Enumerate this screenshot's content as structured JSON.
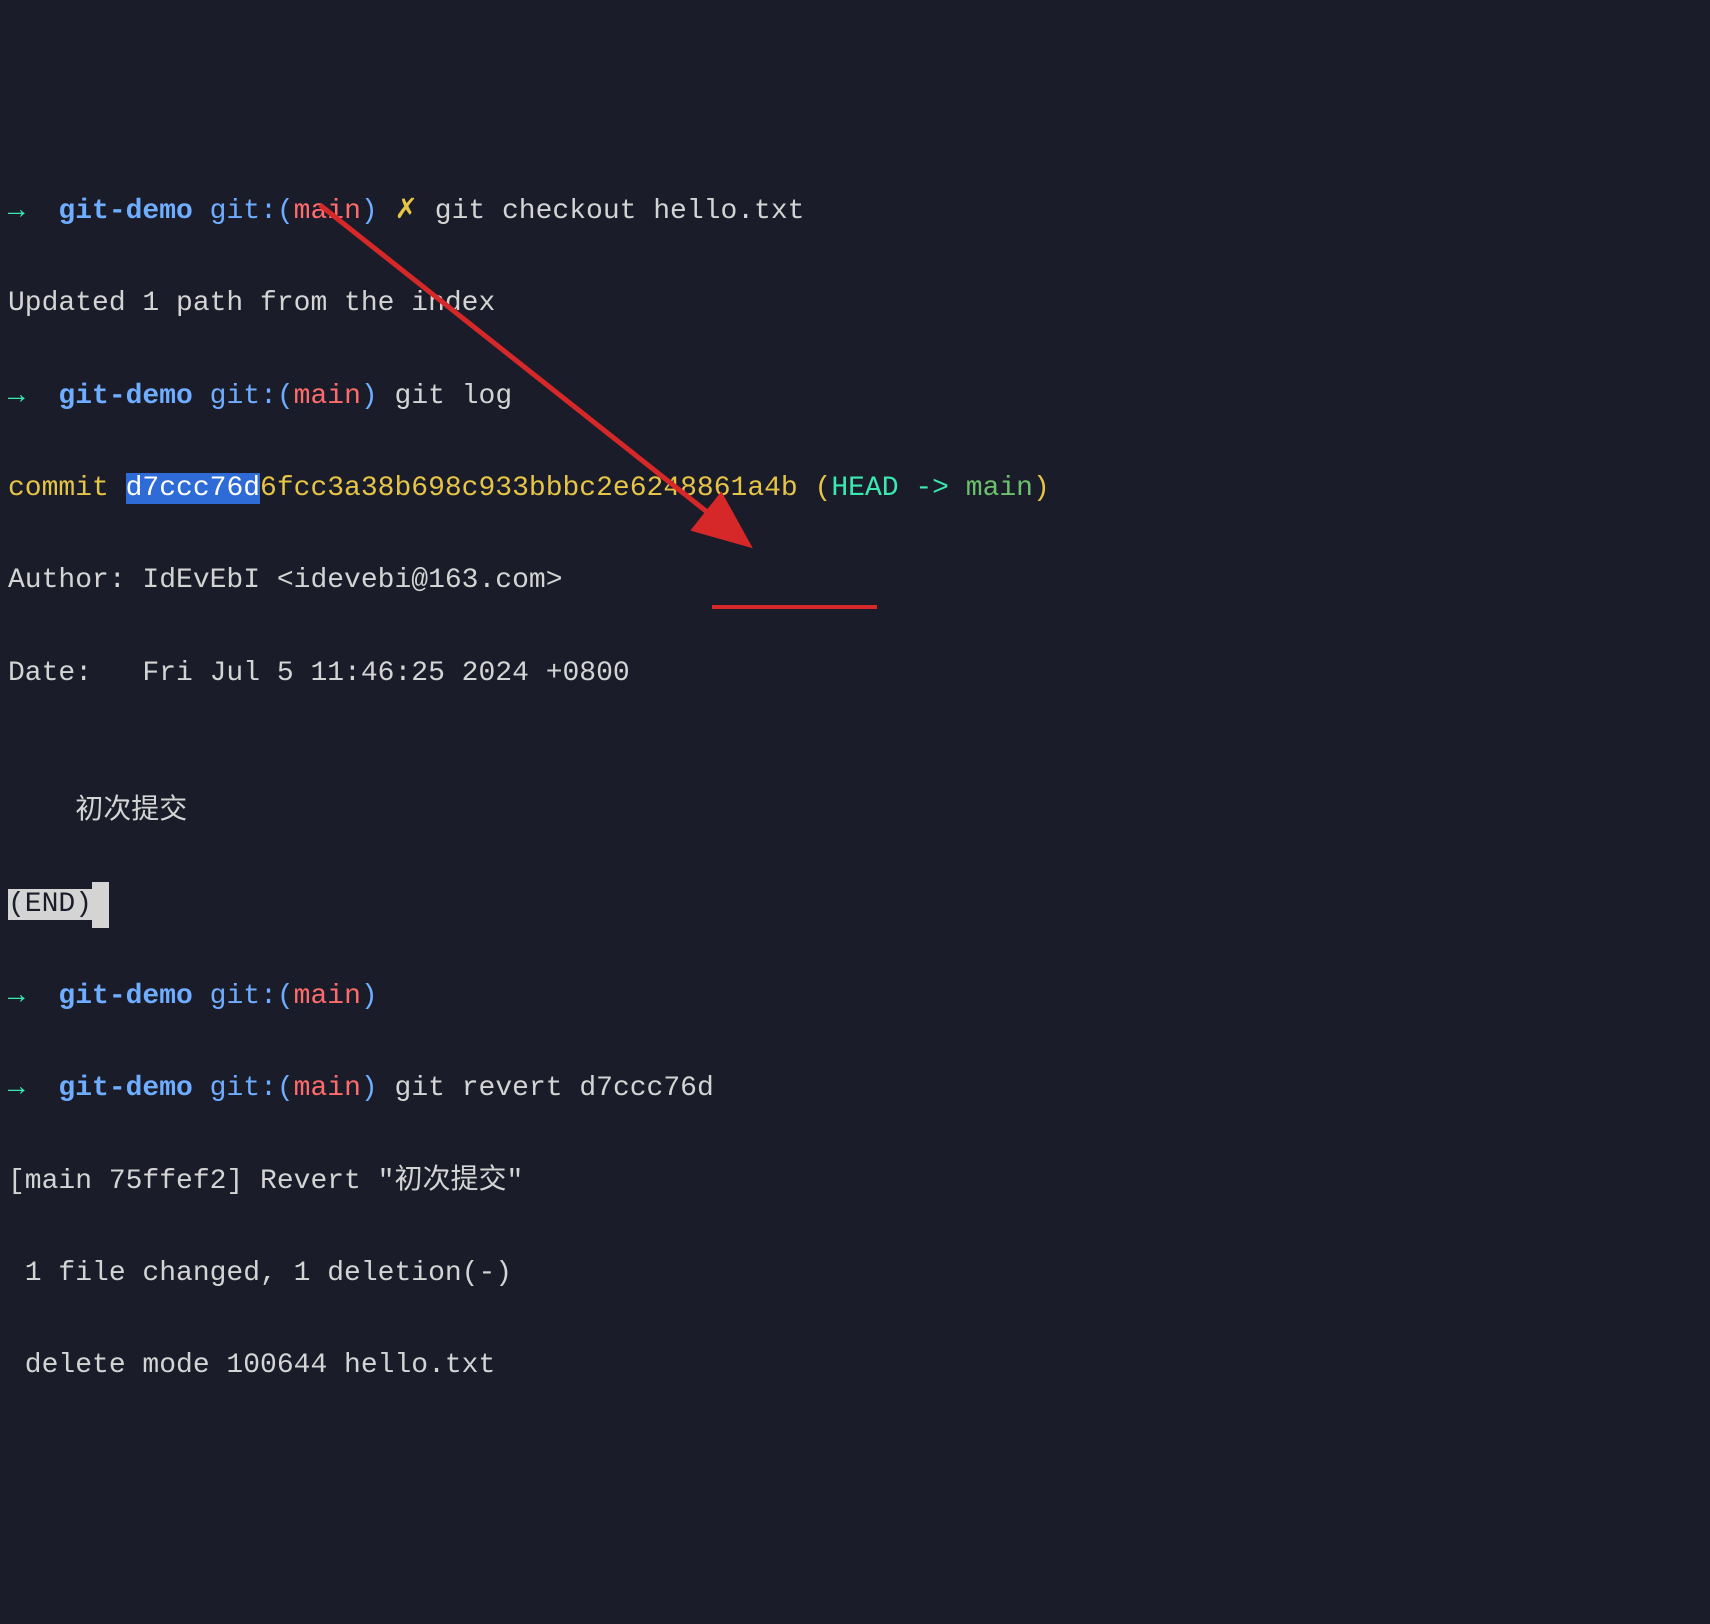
{
  "prompt": {
    "arrow": "→",
    "dir": "git-demo",
    "git_label": "git:(",
    "branch": "main",
    "close_paren": ")",
    "dirty_marker": "✗"
  },
  "lines": {
    "l1_cmd": "git checkout hello.txt",
    "l2_output": "Updated 1 path from the index",
    "l3_cmd": "git log",
    "l4_commit_word": "commit ",
    "l4_hash_sel": "d7ccc76d",
    "l4_hash_rest": "6fcc3a38b698c933bbbc2e6248861a4b",
    "l4_refs_open": " (",
    "l4_head": "HEAD -> ",
    "l4_branch": "main",
    "l4_refs_close": ")",
    "l5_author": "Author: IdEvEbI <idevebi@163.com>",
    "l6_date": "Date:   Fri Jul 5 11:46:25 2024 +0800",
    "l7_blank": "",
    "l8_msg": "    初次提交",
    "l9_end": "(END)",
    "l11_cmd": "git revert d7ccc76d",
    "l12_out": "[main 75ffef2] Revert \"初次提交\"",
    "l13_out": " 1 file changed, 1 deletion(-)",
    "l14_out": " delete mode 100644 hello.txt"
  },
  "annotations": {
    "arrow_color": "#d62828"
  }
}
